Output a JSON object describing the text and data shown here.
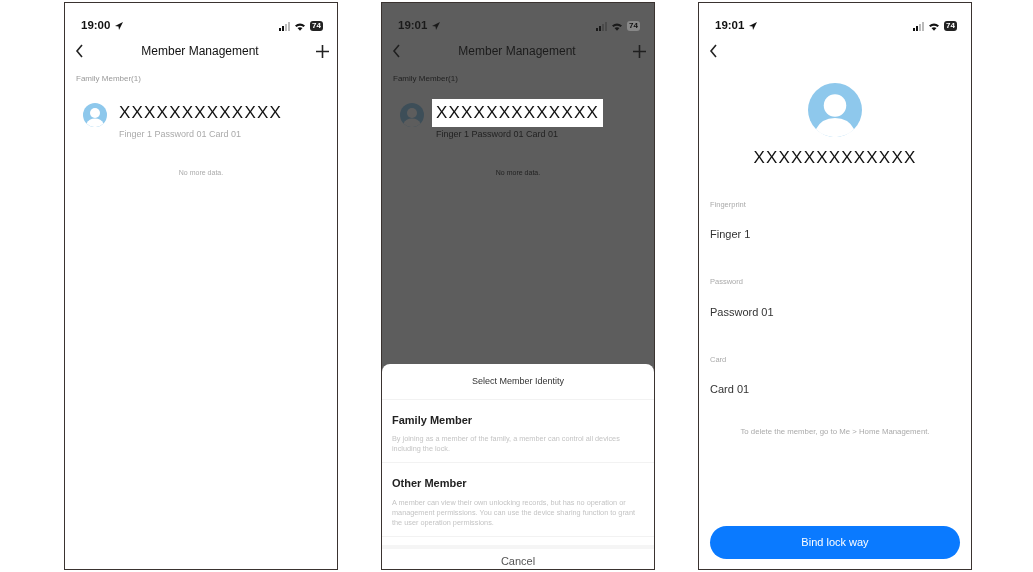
{
  "screens": [
    {
      "kind": "list",
      "dimmed": false,
      "status_bar": {
        "time": "19:00",
        "battery": "74"
      },
      "title": "Member Management",
      "section": "Family Member(1)",
      "members": [
        {
          "name": "XXXXXXXXXXXXX",
          "detail": "Finger 1 Password 01 Card 01"
        }
      ],
      "footer": "No more data."
    },
    {
      "kind": "list",
      "dimmed": true,
      "status_bar": {
        "time": "19:01",
        "battery": "74"
      },
      "title": "Member Management",
      "section": "Family Member(1)",
      "members": [
        {
          "name": "XXXXXXXXXXXXX",
          "detail": "Finger 1 Password 01 Card 01"
        }
      ],
      "footer": "No more data.",
      "sheet": {
        "title": "Select Member Identity",
        "options": [
          {
            "label": "Family Member",
            "description": "By joining as a member of the family, a member can control all devices including the lock."
          },
          {
            "label": "Other Member",
            "description": "A member can view their own unlocking records, but has no operation or management permissions. You can use the device sharing function to grant the user operation permissions."
          }
        ],
        "cancel": "Cancel"
      }
    },
    {
      "kind": "detail",
      "dimmed": false,
      "status_bar": {
        "time": "19:01",
        "battery": "74"
      },
      "name": "XXXXXXXXXXXXX",
      "fields": [
        {
          "label": "Fingerprint",
          "value": "Finger 1"
        },
        {
          "label": "Password",
          "value": "Password 01"
        },
        {
          "label": "Card",
          "value": "Card 01"
        }
      ],
      "note": "To delete the member, go to Me > Home Management.",
      "button": "Bind lock way"
    }
  ]
}
